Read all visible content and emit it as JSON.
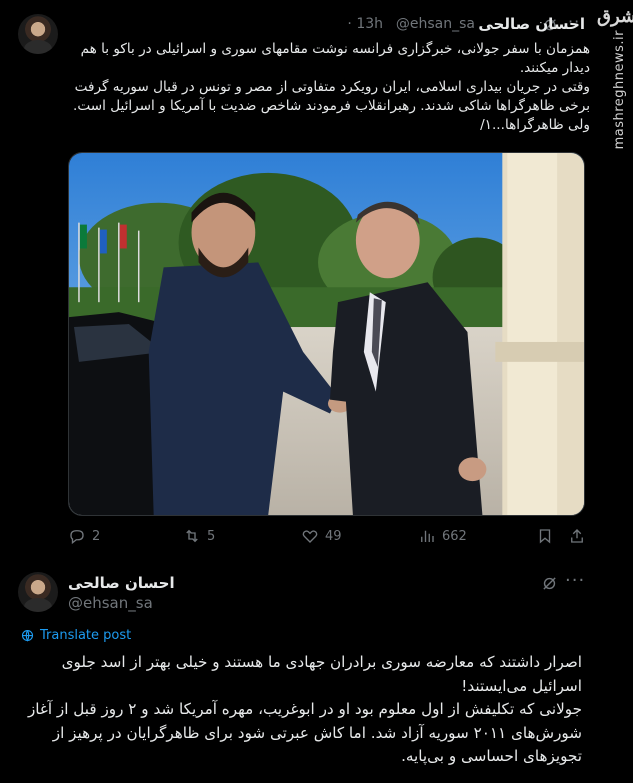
{
  "watermark": {
    "logo": "مشرق",
    "site": "mashreghnews.ir"
  },
  "tweet1": {
    "author_name": "احسان صالحی",
    "handle": "@ehsan_sa",
    "separator": "·",
    "time": "13h",
    "paragraph1": "همزمان با سفر جولانی، خبرگزاری فرانسه نوشت مقامهای سوری و اسرائیلی در باکو با هم دیدار میکنند.",
    "paragraph2": "وقتی در جریان بیداری اسلامی، ایران رویکرد متفاوتی از مصر و تونس در قبال سوریه گرفت برخی ظاهرگراها شاکی شدند. رهبرانقلاب فرمودند شاخص ضدیت با آمریکا و اسرائیل است. ولی ظاهرگراها...۱/",
    "stats": {
      "replies": "2",
      "reposts": "5",
      "likes": "49",
      "views": "662"
    }
  },
  "tweet2": {
    "author_name": "احسان صالحی",
    "handle": "@ehsan_sa",
    "translate_label": "Translate post",
    "paragraph1": "اصرار داشتند که معارضه سوری برادران جهادی ما هستند و خیلی بهتر از اسد جلوی اسرائیل می‌ایستند!",
    "paragraph2": "جولانی که تکلیفش از اول معلوم بود او در ابوغریب، مهره آمریکا شد و ۲ روز قبل از آغاز شورش‌های ۲۰۱۱ سوریه آزاد شد. اما کاش عبرتی شود برای ظاهرگرایان در پرهیز از تجویزهای احساسی و بی‌پایه."
  },
  "icons": {
    "grok": "grok-icon",
    "more": "more-icon",
    "reply": "reply-icon",
    "repost": "repost-icon",
    "like": "heart-icon",
    "views": "views-icon",
    "bookmark": "bookmark-icon",
    "share": "share-icon",
    "translate": "globe-icon"
  },
  "colors": {
    "background": "#000000",
    "text": "#e7e9ea",
    "muted": "#71767b",
    "link": "#1d9bf0"
  }
}
